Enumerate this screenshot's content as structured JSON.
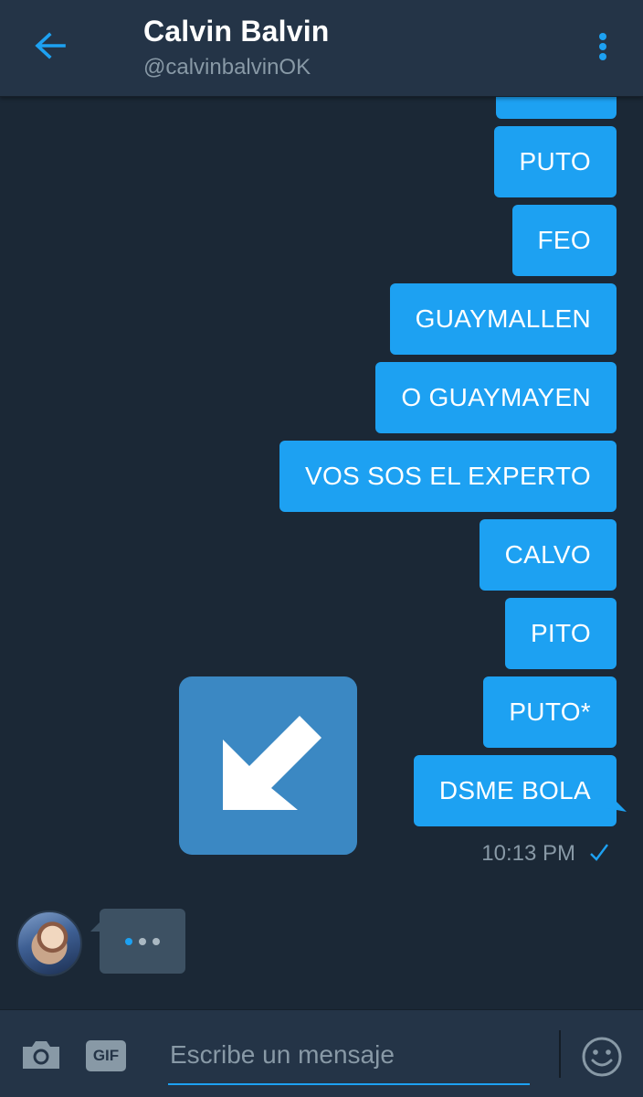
{
  "header": {
    "title": "Calvin Balvin",
    "handle": "@calvinbalvinOK",
    "back_icon": "arrow-left-icon",
    "menu_icon": "more-vertical-icon"
  },
  "thread": {
    "messages": [
      {
        "text": ""
      },
      {
        "text": "PUTO"
      },
      {
        "text": "FEO"
      },
      {
        "text": "GUAYMALLEN"
      },
      {
        "text": "O GUAYMAYEN"
      },
      {
        "text": "VOS SOS EL EXPERTO"
      },
      {
        "text": "CALVO"
      },
      {
        "text": "PITO"
      },
      {
        "text": "PUTO*"
      },
      {
        "text": "DSME BOLA"
      }
    ],
    "timestamp": "10:13 PM",
    "sent_icon": "check-icon",
    "sticker_icon": "arrow-down-left-icon",
    "typing_icon": "typing-dots-icon"
  },
  "composer": {
    "camera_icon": "camera-icon",
    "gif_label": "GIF",
    "placeholder": "Escribe un mensaje",
    "emoji_icon": "smiley-icon"
  },
  "colors": {
    "background": "#1b2836",
    "header": "#243447",
    "accent": "#1da1f2",
    "bubble": "#1da1f2",
    "secondary_text": "#8899a6",
    "sticker": "#3b88c3",
    "typing_bubble": "#3d5163"
  }
}
